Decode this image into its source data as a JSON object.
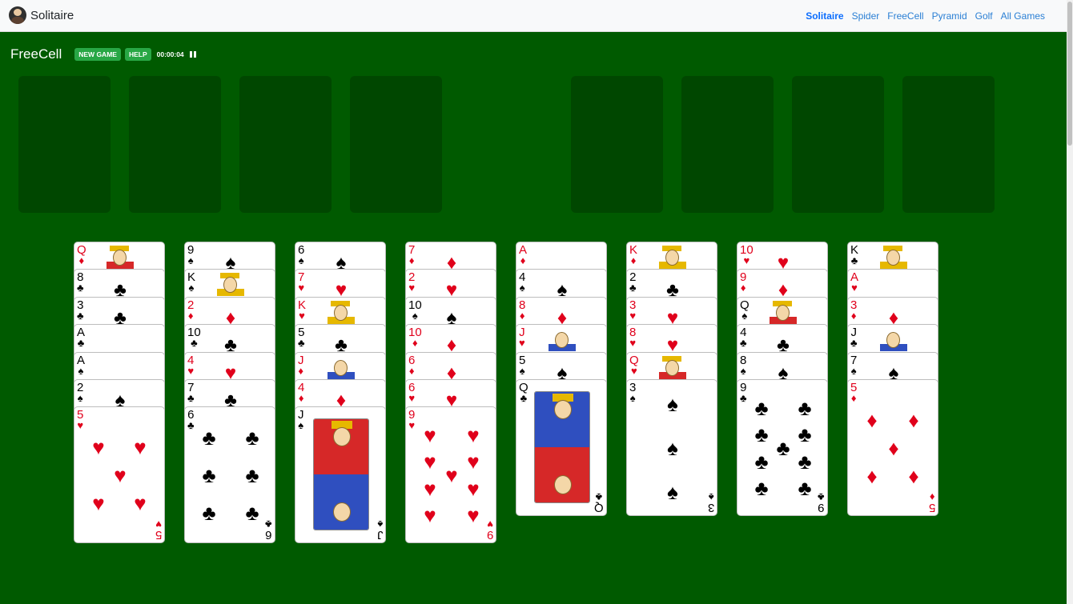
{
  "nav": {
    "brand": "Solitaire",
    "links": [
      "Solitaire",
      "Spider",
      "FreeCell",
      "Pyramid",
      "Golf",
      "All Games"
    ],
    "active_link": "Solitaire"
  },
  "toolbar": {
    "game_title": "FreeCell",
    "new_game_label": "NEW GAME",
    "help_label": "HELP",
    "timer": "00:00:04"
  },
  "colors": {
    "table": "#005a00",
    "slot": "#004700",
    "button": "#28a745",
    "red_suit": "#e0001b",
    "link": "#2a7fd4"
  },
  "free_cells": 4,
  "foundations": 4,
  "tableau": [
    [
      {
        "rank": "Q",
        "suit": "♦"
      },
      {
        "rank": "8",
        "suit": "♣"
      },
      {
        "rank": "3",
        "suit": "♣"
      },
      {
        "rank": "A",
        "suit": "♣"
      },
      {
        "rank": "A",
        "suit": "♠"
      },
      {
        "rank": "2",
        "suit": "♠"
      },
      {
        "rank": "5",
        "suit": "♥"
      }
    ],
    [
      {
        "rank": "9",
        "suit": "♠"
      },
      {
        "rank": "K",
        "suit": "♠"
      },
      {
        "rank": "2",
        "suit": "♦"
      },
      {
        "rank": "10",
        "suit": "♣"
      },
      {
        "rank": "4",
        "suit": "♥"
      },
      {
        "rank": "7",
        "suit": "♣"
      },
      {
        "rank": "6",
        "suit": "♣"
      }
    ],
    [
      {
        "rank": "6",
        "suit": "♠"
      },
      {
        "rank": "7",
        "suit": "♥"
      },
      {
        "rank": "K",
        "suit": "♥"
      },
      {
        "rank": "5",
        "suit": "♣"
      },
      {
        "rank": "J",
        "suit": "♦"
      },
      {
        "rank": "4",
        "suit": "♦"
      },
      {
        "rank": "J",
        "suit": "♠"
      }
    ],
    [
      {
        "rank": "7",
        "suit": "♦"
      },
      {
        "rank": "2",
        "suit": "♥"
      },
      {
        "rank": "10",
        "suit": "♠"
      },
      {
        "rank": "10",
        "suit": "♦"
      },
      {
        "rank": "6",
        "suit": "♦"
      },
      {
        "rank": "6",
        "suit": "♥"
      },
      {
        "rank": "9",
        "suit": "♥"
      }
    ],
    [
      {
        "rank": "A",
        "suit": "♦"
      },
      {
        "rank": "4",
        "suit": "♠"
      },
      {
        "rank": "8",
        "suit": "♦"
      },
      {
        "rank": "J",
        "suit": "♥"
      },
      {
        "rank": "5",
        "suit": "♠"
      },
      {
        "rank": "Q",
        "suit": "♣"
      }
    ],
    [
      {
        "rank": "K",
        "suit": "♦"
      },
      {
        "rank": "2",
        "suit": "♣"
      },
      {
        "rank": "3",
        "suit": "♥"
      },
      {
        "rank": "8",
        "suit": "♥"
      },
      {
        "rank": "Q",
        "suit": "♥"
      },
      {
        "rank": "3",
        "suit": "♠"
      }
    ],
    [
      {
        "rank": "10",
        "suit": "♥"
      },
      {
        "rank": "9",
        "suit": "♦"
      },
      {
        "rank": "Q",
        "suit": "♠"
      },
      {
        "rank": "4",
        "suit": "♣"
      },
      {
        "rank": "8",
        "suit": "♠"
      },
      {
        "rank": "9",
        "suit": "♣"
      }
    ],
    [
      {
        "rank": "K",
        "suit": "♣"
      },
      {
        "rank": "A",
        "suit": "♥"
      },
      {
        "rank": "3",
        "suit": "♦"
      },
      {
        "rank": "J",
        "suit": "♣"
      },
      {
        "rank": "7",
        "suit": "♠"
      },
      {
        "rank": "5",
        "suit": "♦"
      }
    ]
  ]
}
